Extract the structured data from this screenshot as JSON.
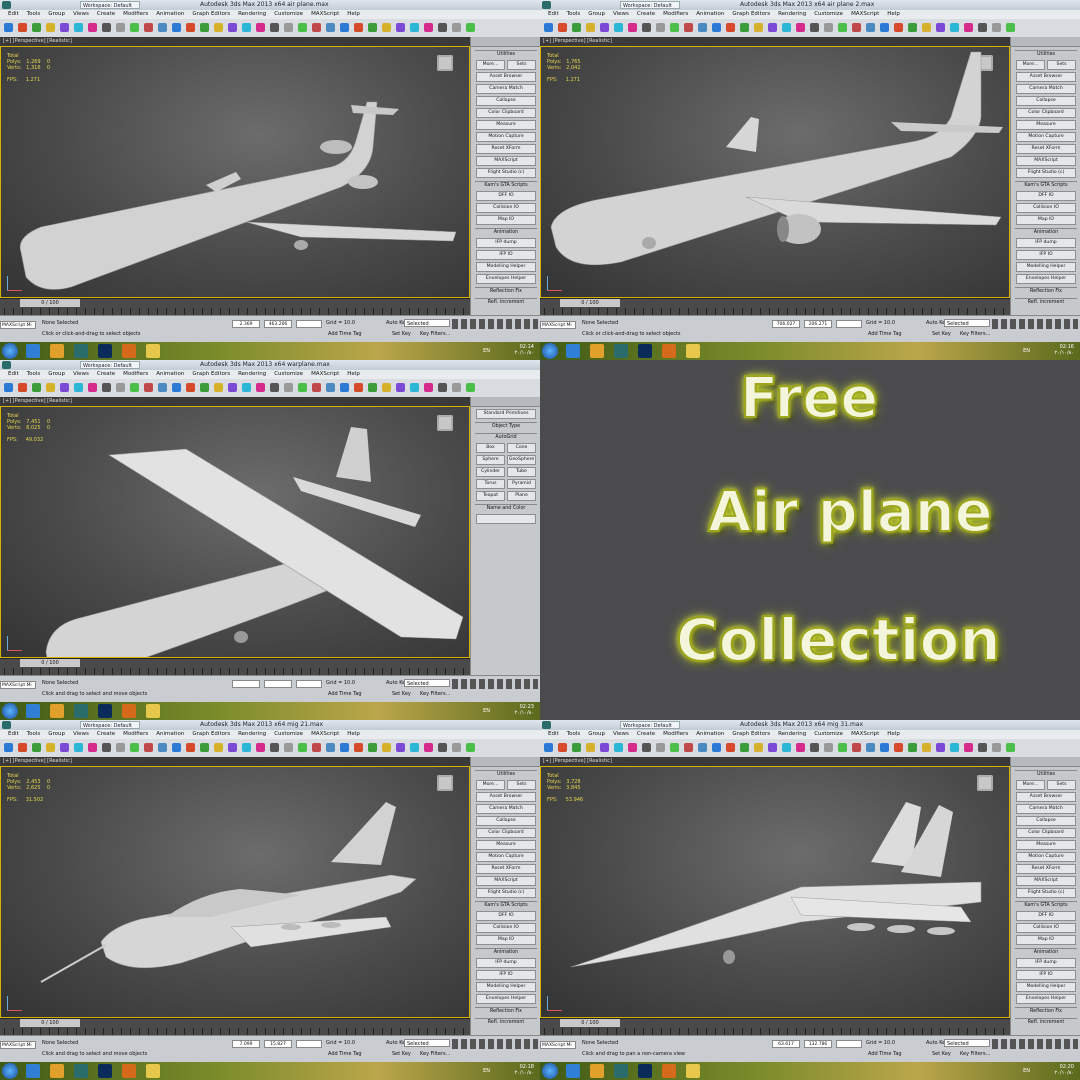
{
  "screens": [
    {
      "title": "Autodesk 3ds Max 2013 x64     air plane.max",
      "workspace": "Workspace: Default",
      "viewport_label": "[+] [Perspective] [Realistic]",
      "stats": "Total\nPolys:   1,269    0\nVerts:   1,316    0\n\nFPS:     1.271",
      "hint": "Click or click-and-drag to select objects",
      "clock": "02:14\n۲۰/۱۰/۸۰",
      "coord_x": "2.369",
      "coord_y": "463.206",
      "panel_kind": "utilities"
    },
    {
      "title": "Autodesk 3ds Max 2013 x64     air plane 2.max",
      "workspace": "Workspace: Default",
      "viewport_label": "[+] [Perspective] [Realistic]",
      "stats": "Total\nPolys:   1,765\nVerts:   2,042\n\nFPS:     1.271",
      "hint": "Click or click-and-drag to select objects",
      "clock": "02:16\n۲۰/۱۰/۸۰",
      "coord_x": "706.027",
      "coord_y": "206.271",
      "panel_kind": "utilities"
    },
    {
      "title": "Autodesk 3ds Max 2013 x64     warplane.max",
      "workspace": "Workspace: Default",
      "viewport_label": "[+] [Perspective] [Realistic]",
      "stats": "Total\nPolys:   7,451    0\nVerts:   8,025    0\n\nFPS:     49.032",
      "hint": "Click and drag to select and move objects",
      "clock": "02:23\n۲۰/۱۰/۸۰",
      "coord_x": "",
      "coord_y": "",
      "panel_kind": "create"
    },
    {
      "title": "Autodesk 3ds Max 2013 x64     mig 21.max",
      "workspace": "Workspace: Default",
      "viewport_label": "[+] [Perspective] [Realistic]",
      "stats": "Total\nPolys:   2,453    0\nVerts:   2,625    0\n\nFPS:     31.502",
      "hint": "Click and drag to select and move objects",
      "clock": "02:18\n۲۰/۱۰/۸۰",
      "coord_x": "7.099",
      "coord_y": "15.827",
      "panel_kind": "utilities"
    },
    {
      "title": "Autodesk 3ds Max 2013 x64     mig 31.max",
      "workspace": "Workspace: Default",
      "viewport_label": "[+] [Perspective] [Realistic]",
      "stats": "Total\nPolys:   3,728\nVerts:   3,845\n\nFPS:     53.946",
      "hint": "Click and drag to pan a non-camera view",
      "clock": "02:20\n۲۰/۱۰/۸۰",
      "coord_x": "63.617",
      "coord_y": "132.786",
      "panel_kind": "utilities"
    }
  ],
  "menu": [
    "Edit",
    "Tools",
    "Group",
    "Views",
    "Create",
    "Modifiers",
    "Animation",
    "Graph Editors",
    "Rendering",
    "Customize",
    "MAXScript",
    "Help"
  ],
  "utilities": {
    "header": "Utilities",
    "more": "More...",
    "sets": "Sets",
    "buttons": [
      "Asset Browser",
      "Camera Match",
      "Collapse",
      "Color Clipboard",
      "Measure",
      "Motion Capture",
      "Reset XForm",
      "MAXScript",
      "Flight Studio (c)"
    ],
    "gta_header": "Kam's GTA Scripts",
    "gta_buttons": [
      "DFF IO",
      "Collision IO",
      "Map IO"
    ],
    "anim_header": "Animation",
    "anim_buttons": [
      "IFP dump",
      "IFP IO"
    ],
    "helper_buttons": [
      "Modelling Helper",
      "Envelopes Helper"
    ],
    "reflection": "Reflection Fix",
    "refl_inc": "Refl. increment"
  },
  "create": {
    "dropdown": "Standard Primitives",
    "object_type": "Object Type",
    "autogrid": "AutoGrid",
    "prims": [
      "Box",
      "Cone",
      "Sphere",
      "GeoSphere",
      "Cylinder",
      "Tube",
      "Torus",
      "Pyramid",
      "Teapot",
      "Plane"
    ],
    "name_color": "Name and Color"
  },
  "status": {
    "maxscript": "MAXScript Mi",
    "none_selected": "None Selected",
    "grid": "Grid = 10.0",
    "add_time_tag": "Add Time Tag",
    "auto_key": "Auto Key",
    "selected": "Selected",
    "set_key": "Set Key",
    "key_filters": "Key Filters...",
    "frame_counter": "0 / 100",
    "lang": "EN"
  },
  "promo": {
    "line1": "Free",
    "line2": "Air plane",
    "line3": "Collection"
  },
  "colors": {
    "viewport_border": "#d7b300",
    "promo_glow": "#e8ff3a",
    "promo_bg": "#4b4b4e"
  },
  "icons": [
    "max-logo-icon",
    "undo-icon",
    "redo-icon",
    "select-icon",
    "move-icon",
    "rotate-icon",
    "scale-icon",
    "viewcube-icon",
    "start-orb-icon",
    "ie-icon",
    "chrome-icon",
    "photoshop-icon",
    "firefox-icon",
    "folder-icon"
  ]
}
